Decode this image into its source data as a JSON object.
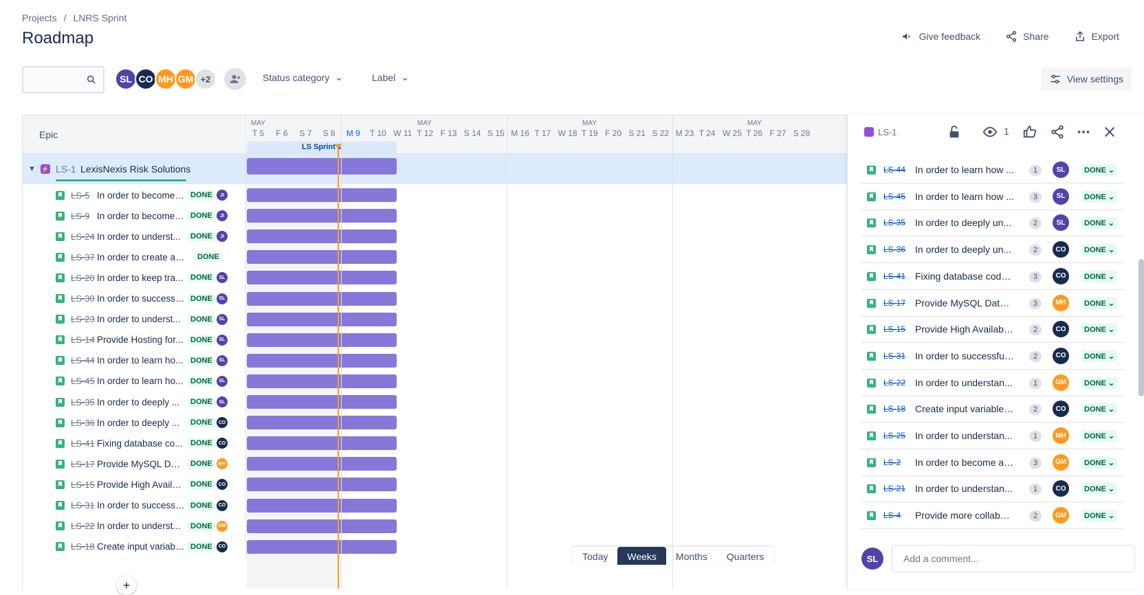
{
  "breadcrumb": {
    "projects": "Projects",
    "separator": "/",
    "project": "LNRS Sprint"
  },
  "page_title": "Roadmap",
  "header_actions": {
    "feedback": "Give feedback",
    "share": "Share",
    "export": "Export"
  },
  "filters": {
    "avatars": [
      {
        "initials": "SL",
        "color": "#5243aa"
      },
      {
        "initials": "CO",
        "color": "#172b4d"
      },
      {
        "initials": "MH",
        "color": "#ff991f"
      },
      {
        "initials": "GM",
        "color": "#ff991f"
      }
    ],
    "more_count": "+2",
    "status_category": "Status category",
    "label": "Label",
    "view_settings": "View settings"
  },
  "timeline": {
    "epic_column": "Epic",
    "months": [
      "MAY",
      "MAY",
      "MAY",
      "MAY"
    ],
    "days": [
      "T 5",
      "F 6",
      "S 7",
      "S 8",
      "M 9",
      "T 10",
      "W 11",
      "T 12",
      "F 13",
      "S 14",
      "S 15",
      "M 16",
      "T 17",
      "W 18",
      "T 19",
      "F 20",
      "S 21",
      "S 22",
      "M 23",
      "T 24",
      "W 25",
      "T 26",
      "F 27",
      "S 28"
    ],
    "sprint": "LS Sprint 1",
    "zoom": {
      "today": "Today",
      "weeks": "Weeks",
      "months": "Months",
      "quarters": "Quarters"
    }
  },
  "epic": {
    "key": "LS-1",
    "title": "LexisNexis Risk Solutions"
  },
  "stories": [
    {
      "key": "LS-5",
      "title": "In order to become ...",
      "status": "DONE",
      "av": "JI",
      "color": "#5243aa"
    },
    {
      "key": "LS-9",
      "title": "In order to become ...",
      "status": "DONE",
      "av": "JI",
      "color": "#5243aa"
    },
    {
      "key": "LS-24",
      "title": "In order to underst...",
      "status": "DONE",
      "av": "JI",
      "color": "#5243aa"
    },
    {
      "key": "LS-37",
      "title": "In order to create a Virt...",
      "status": "DONE",
      "av": "",
      "color": ""
    },
    {
      "key": "LS-20",
      "title": "In order to keep tra...",
      "status": "DONE",
      "av": "SL",
      "color": "#5243aa"
    },
    {
      "key": "LS-30",
      "title": "In order to successf...",
      "status": "DONE",
      "av": "SL",
      "color": "#5243aa"
    },
    {
      "key": "LS-23",
      "title": "In order to underst...",
      "status": "DONE",
      "av": "SL",
      "color": "#5243aa"
    },
    {
      "key": "LS-14",
      "title": "Provide Hosting for...",
      "status": "DONE",
      "av": "SL",
      "color": "#5243aa"
    },
    {
      "key": "LS-44",
      "title": "In order to learn ho...",
      "status": "DONE",
      "av": "SL",
      "color": "#5243aa"
    },
    {
      "key": "LS-45",
      "title": "In order to learn ho...",
      "status": "DONE",
      "av": "SL",
      "color": "#5243aa"
    },
    {
      "key": "LS-35",
      "title": "In order to deeply ...",
      "status": "DONE",
      "av": "SL",
      "color": "#5243aa"
    },
    {
      "key": "LS-36",
      "title": "In order to deeply ...",
      "status": "DONE",
      "av": "CO",
      "color": "#172b4d"
    },
    {
      "key": "LS-41",
      "title": "Fixing database co...",
      "status": "DONE",
      "av": "CO",
      "color": "#172b4d"
    },
    {
      "key": "LS-17",
      "title": "Provide MySQL Dat...",
      "status": "DONE",
      "av": "MH",
      "color": "#ff991f"
    },
    {
      "key": "LS-15",
      "title": "Provide High Availa...",
      "status": "DONE",
      "av": "CO",
      "color": "#172b4d"
    },
    {
      "key": "LS-31",
      "title": "In order to successf...",
      "status": "DONE",
      "av": "CO",
      "color": "#172b4d"
    },
    {
      "key": "LS-22",
      "title": "In order to underst...",
      "status": "DONE",
      "av": "GM",
      "color": "#ff991f"
    },
    {
      "key": "LS-18",
      "title": "Create input variabl...",
      "status": "DONE",
      "av": "CO",
      "color": "#172b4d"
    }
  ],
  "panel": {
    "key": "LS-1",
    "watch_count": "1",
    "children": [
      {
        "key": "LS-44",
        "title": "In order to learn how ...",
        "pts": "1",
        "av": "SL",
        "color": "#5243aa",
        "status": "DONE"
      },
      {
        "key": "LS-45",
        "title": "In order to learn how ...",
        "pts": "3",
        "av": "SL",
        "color": "#5243aa",
        "status": "DONE"
      },
      {
        "key": "LS-35",
        "title": "In order to deeply un...",
        "pts": "2",
        "av": "SL",
        "color": "#5243aa",
        "status": "DONE"
      },
      {
        "key": "LS-36",
        "title": "In order to deeply un...",
        "pts": "2",
        "av": "CO",
        "color": "#172b4d",
        "status": "DONE"
      },
      {
        "key": "LS-41",
        "title": "Fixing database code ...",
        "pts": "3",
        "av": "CO",
        "color": "#172b4d",
        "status": "DONE"
      },
      {
        "key": "LS-17",
        "title": "Provide MySQL Datab...",
        "pts": "3",
        "av": "MH",
        "color": "#ff991f",
        "status": "DONE"
      },
      {
        "key": "LS-15",
        "title": "Provide High Availabil...",
        "pts": "2",
        "av": "CO",
        "color": "#172b4d",
        "status": "DONE"
      },
      {
        "key": "LS-31",
        "title": "In order to successfull...",
        "pts": "2",
        "av": "CO",
        "color": "#172b4d",
        "status": "DONE"
      },
      {
        "key": "LS-22",
        "title": "In order to understan...",
        "pts": "1",
        "av": "GM",
        "color": "#ff991f",
        "status": "DONE"
      },
      {
        "key": "LS-18",
        "title": "Create input variables ...",
        "pts": "2",
        "av": "CO",
        "color": "#172b4d",
        "status": "DONE"
      },
      {
        "key": "LS-25",
        "title": "In order to understan...",
        "pts": "1",
        "av": "MH",
        "color": "#ff991f",
        "status": "DONE"
      },
      {
        "key": "LS-2",
        "title": "In order to become a S...",
        "pts": "3",
        "av": "GM",
        "color": "#ff991f",
        "status": "DONE"
      },
      {
        "key": "LS-21",
        "title": "In order to understan...",
        "pts": "1",
        "av": "CO",
        "color": "#172b4d",
        "status": "DONE"
      },
      {
        "key": "LS-4",
        "title": "Provide more collabor...",
        "pts": "2",
        "av": "GM",
        "color": "#ff991f",
        "status": "DONE"
      }
    ],
    "comment_avatar": "SL",
    "comment_placeholder": "Add a comment..."
  }
}
